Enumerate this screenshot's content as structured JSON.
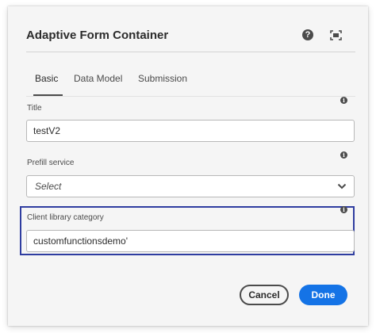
{
  "dialog": {
    "title": "Adaptive Form Container",
    "help_glyph": "?",
    "icons": {
      "help": "help-icon",
      "fullscreen": "fullscreen-icon"
    }
  },
  "tabs": [
    {
      "label": "Basic",
      "active": true
    },
    {
      "label": "Data Model",
      "active": false
    },
    {
      "label": "Submission",
      "active": false
    }
  ],
  "fields": {
    "title": {
      "label": "Title",
      "value": "testV2"
    },
    "prefill": {
      "label": "Prefill service",
      "value": "Select"
    },
    "client_library": {
      "label": "Client library category",
      "value": "customfunctionsdemo'"
    }
  },
  "info_glyph": "i",
  "buttons": {
    "cancel": "Cancel",
    "done": "Done"
  },
  "colors": {
    "accent": "#1473e6",
    "highlight": "#2f3da0",
    "dialog_bg": "#f5f5f5"
  }
}
